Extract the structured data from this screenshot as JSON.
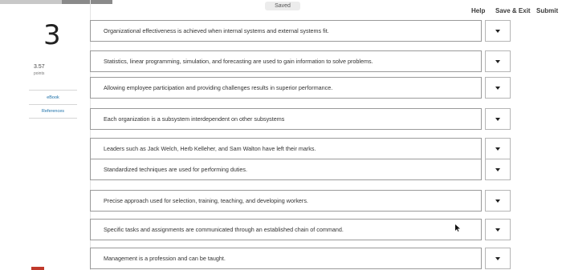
{
  "header": {
    "progress_fraction": 0.55,
    "saved_label": "Saved",
    "help_label": "Help",
    "save_exit_label": "Save & Exit",
    "submit_label": "Submit"
  },
  "question": {
    "number": "3",
    "points_value": "3.57",
    "points_label": "points"
  },
  "side_links": {
    "ebook": "eBook",
    "references": "References"
  },
  "items": [
    {
      "text": "Organizational effectiveness is achieved when internal systems and external systems fit."
    },
    {
      "text": "Statistics, linear programming, simulation, and forecasting are used to gain information to solve problems."
    },
    {
      "text": "Allowing employee participation and providing challenges results in superior performance."
    },
    {
      "text": "Each organization is a subsystem interdependent on other subsystems"
    },
    {
      "text": "Leaders such as Jack Welch, Herb Kelleher, and Sam Walton have left their marks."
    },
    {
      "text": "Standardized techniques are used for performing duties."
    },
    {
      "text": "Precise approach used for selection, training, teaching, and developing workers."
    },
    {
      "text": "Specific tasks and assignments are communicated through an established chain of command."
    },
    {
      "text": "Management is a profession and can be taught."
    }
  ]
}
